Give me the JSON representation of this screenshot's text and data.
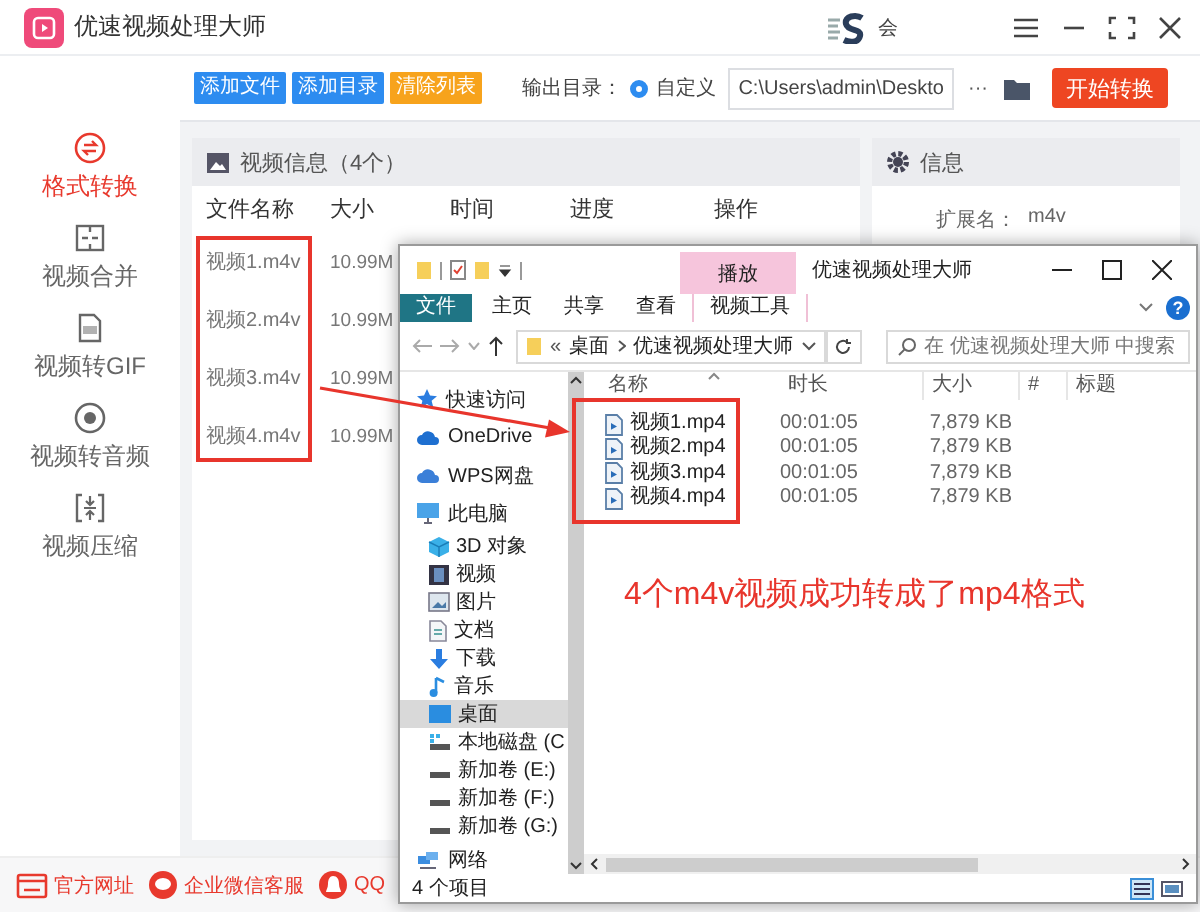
{
  "app": {
    "title": "优速视频处理大师",
    "vip_label": "会",
    "sidebar": [
      {
        "label": "格式转换",
        "selected": true
      },
      {
        "label": "视频合并",
        "selected": false
      },
      {
        "label": "视频转GIF",
        "selected": false
      },
      {
        "label": "视频转音频",
        "selected": false
      },
      {
        "label": "视频压缩",
        "selected": false
      }
    ],
    "toolbar": {
      "buttons": [
        {
          "label": "添加文件",
          "color": "#2d8cf0"
        },
        {
          "label": "添加目录",
          "color": "#2d8cf0"
        },
        {
          "label": "清除列表",
          "color": "#f7a31c"
        }
      ],
      "output_label": "输出目录：",
      "radio": {
        "label": "自定义",
        "selected": true
      },
      "path": "C:\\Users\\admin\\Deskto",
      "more": "···",
      "start_button": "开始转换"
    },
    "video_panel": {
      "title": "视频信息（4个）",
      "columns": [
        "文件名称",
        "大小",
        "时间",
        "进度",
        "操作"
      ],
      "rows": [
        {
          "name": "视频1.m4v",
          "size": "10.99M"
        },
        {
          "name": "视频2.m4v",
          "size": "10.99M"
        },
        {
          "name": "视频3.m4v",
          "size": "10.99M"
        },
        {
          "name": "视频4.m4v",
          "size": "10.99M"
        }
      ]
    },
    "info_panel": {
      "title": "信息",
      "fields": [
        {
          "label": "扩展名：",
          "value": "m4v"
        }
      ]
    },
    "footer": [
      {
        "label": "官方网址"
      },
      {
        "label": "企业微信客服"
      },
      {
        "label": "QQ"
      }
    ]
  },
  "explorer": {
    "context_tab": "播放",
    "title": "优速视频处理大师",
    "ribbon_tabs": [
      {
        "label": "文件",
        "kind": "file"
      },
      {
        "label": "主页",
        "kind": "plain"
      },
      {
        "label": "共享",
        "kind": "plain"
      },
      {
        "label": "查看",
        "kind": "plain"
      },
      {
        "label": "视频工具",
        "kind": "contextual"
      }
    ],
    "help": "?",
    "overflow": "«",
    "breadcrumb": [
      "桌面",
      "优速视频处理大师"
    ],
    "search": {
      "placeholder": "在 优速视频处理大师 中搜索"
    },
    "nav": [
      {
        "label": "快速访问",
        "selected": false
      },
      {
        "label": "OneDrive",
        "selected": false
      },
      {
        "label": "WPS网盘",
        "selected": false
      },
      {
        "label": "此电脑",
        "selected": false,
        "children": [
          {
            "label": "3D 对象",
            "selected": false
          },
          {
            "label": "视频",
            "selected": false
          },
          {
            "label": "图片",
            "selected": false
          },
          {
            "label": "文档",
            "selected": false
          },
          {
            "label": "下载",
            "selected": false
          },
          {
            "label": "音乐",
            "selected": false
          },
          {
            "label": "桌面",
            "selected": true
          },
          {
            "label": "本地磁盘 (C",
            "selected": false
          },
          {
            "label": "新加卷 (E:)",
            "selected": false
          },
          {
            "label": "新加卷 (F:)",
            "selected": false
          },
          {
            "label": "新加卷 (G:)",
            "selected": false
          }
        ]
      },
      {
        "label": "网络",
        "selected": false
      }
    ],
    "columns": [
      "名称",
      "时长",
      "大小",
      "#",
      "标题"
    ],
    "files": [
      {
        "name": "视频1.mp4",
        "duration": "00:01:05",
        "size": "7,879 KB"
      },
      {
        "name": "视频2.mp4",
        "duration": "00:01:05",
        "size": "7,879 KB"
      },
      {
        "name": "视频3.mp4",
        "duration": "00:01:05",
        "size": "7,879 KB"
      },
      {
        "name": "视频4.mp4",
        "duration": "00:01:05",
        "size": "7,879 KB"
      }
    ],
    "annotation": "4个m4v视频成功转成了mp4格式",
    "status": "4 个项目"
  }
}
